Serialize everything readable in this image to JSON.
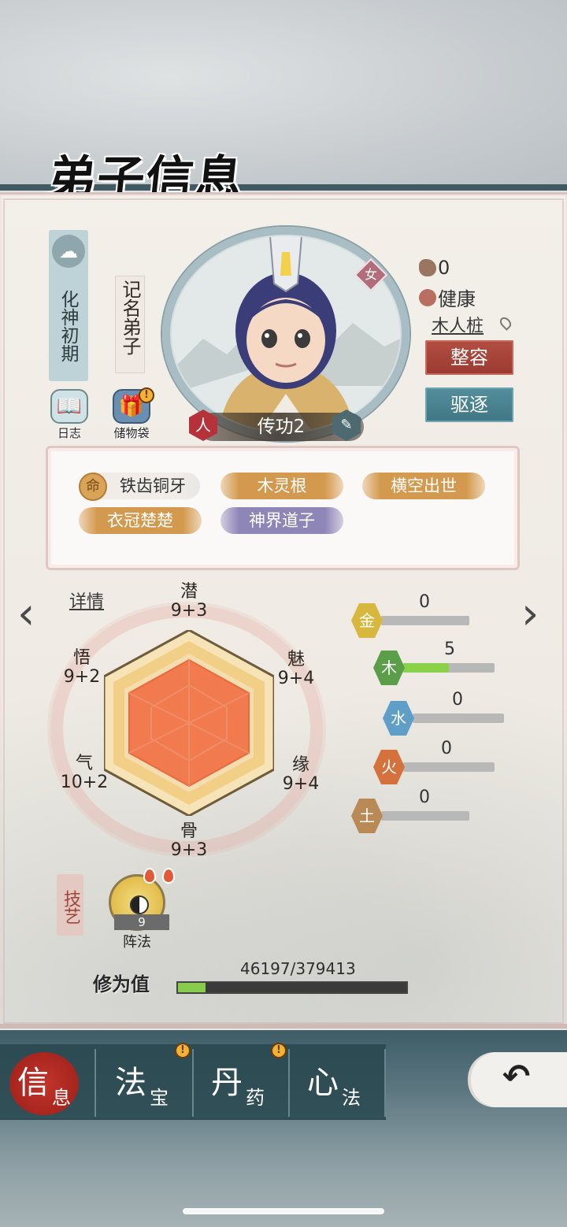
{
  "page": {
    "title": "弟子信息"
  },
  "disciple": {
    "realm": "化神初期",
    "title": "记名弟子",
    "gender": "女",
    "name": "传功2",
    "name_badge_left": "人",
    "likes": "0",
    "health": "健康",
    "location": "木人桩"
  },
  "side_buttons": {
    "log": "日志",
    "storage": "储物袋"
  },
  "actions": {
    "makeover": "整容",
    "expel": "驱逐"
  },
  "traits": [
    {
      "label": "铁齿铜牙",
      "style": "grey",
      "icon": "命"
    },
    {
      "label": "木灵根",
      "style": "gold"
    },
    {
      "label": "横空出世",
      "style": "gold"
    },
    {
      "label": "衣冠楚楚",
      "style": "gold"
    },
    {
      "label": "神界道子",
      "style": "purple"
    }
  ],
  "details_link": "详情",
  "attributes": {
    "qian": {
      "name": "潜",
      "value": "9+3"
    },
    "mei": {
      "name": "魅",
      "value": "9+4"
    },
    "yuan": {
      "name": "缘",
      "value": "9+4"
    },
    "gu": {
      "name": "骨",
      "value": "9+3"
    },
    "qi": {
      "name": "气",
      "value": "10+2"
    },
    "wu": {
      "name": "悟",
      "value": "9+2"
    }
  },
  "elements": [
    {
      "name": "金",
      "value": "0",
      "level": 0,
      "color": "#d8b73f"
    },
    {
      "name": "木",
      "value": "5",
      "level": 0.5,
      "color": "#5a9e4a"
    },
    {
      "name": "水",
      "value": "0",
      "level": 0,
      "color": "#5f9ec6"
    },
    {
      "name": "火",
      "value": "0",
      "level": 0,
      "color": "#d5713d"
    },
    {
      "name": "土",
      "value": "0",
      "level": 0,
      "color": "#b98a55"
    }
  ],
  "skills": {
    "tag": "技艺",
    "items": [
      {
        "name": "阵法",
        "level": "9"
      }
    ]
  },
  "cultivation": {
    "label": "修为值",
    "current": 46197,
    "max": 379413,
    "text": "46197/379413"
  },
  "nav": {
    "tabs": [
      {
        "big": "信",
        "small": "息",
        "active": true
      },
      {
        "big": "法",
        "small": "宝"
      },
      {
        "big": "丹",
        "small": "药"
      },
      {
        "big": "心",
        "small": "法"
      }
    ]
  },
  "colors": {
    "accent_red": "#a7251d",
    "accent_teal": "#3f7683",
    "progress_green": "#87cc4a"
  }
}
